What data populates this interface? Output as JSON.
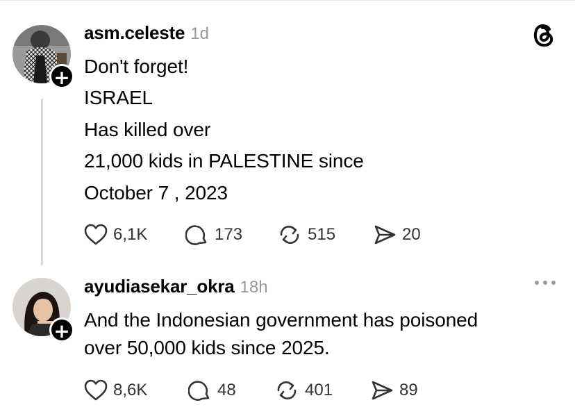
{
  "colors": {
    "text": "#000000",
    "muted": "#999999",
    "icon": "#333333",
    "thread_line": "#d9d9d9"
  },
  "posts": [
    {
      "username": "asm.celeste",
      "time": "1d",
      "avatar_icon": "avatar-keffiyeh-photo",
      "lines": [
        "Don't forget!",
        "ISRAEL",
        "Has killed over",
        "21,000 kids in PALESTINE since",
        "October 7 , 2023"
      ],
      "likes": "6,1K",
      "replies": "173",
      "reposts": "515",
      "shares": "20"
    },
    {
      "username": "ayudiasekar_okra",
      "time": "18h",
      "avatar_icon": "avatar-woman-photo",
      "lines": [
        "And the Indonesian government has poisoned",
        "over 50,000 kids since 2025."
      ],
      "likes": "8,6K",
      "replies": "48",
      "reposts": "401",
      "shares": "89"
    }
  ]
}
